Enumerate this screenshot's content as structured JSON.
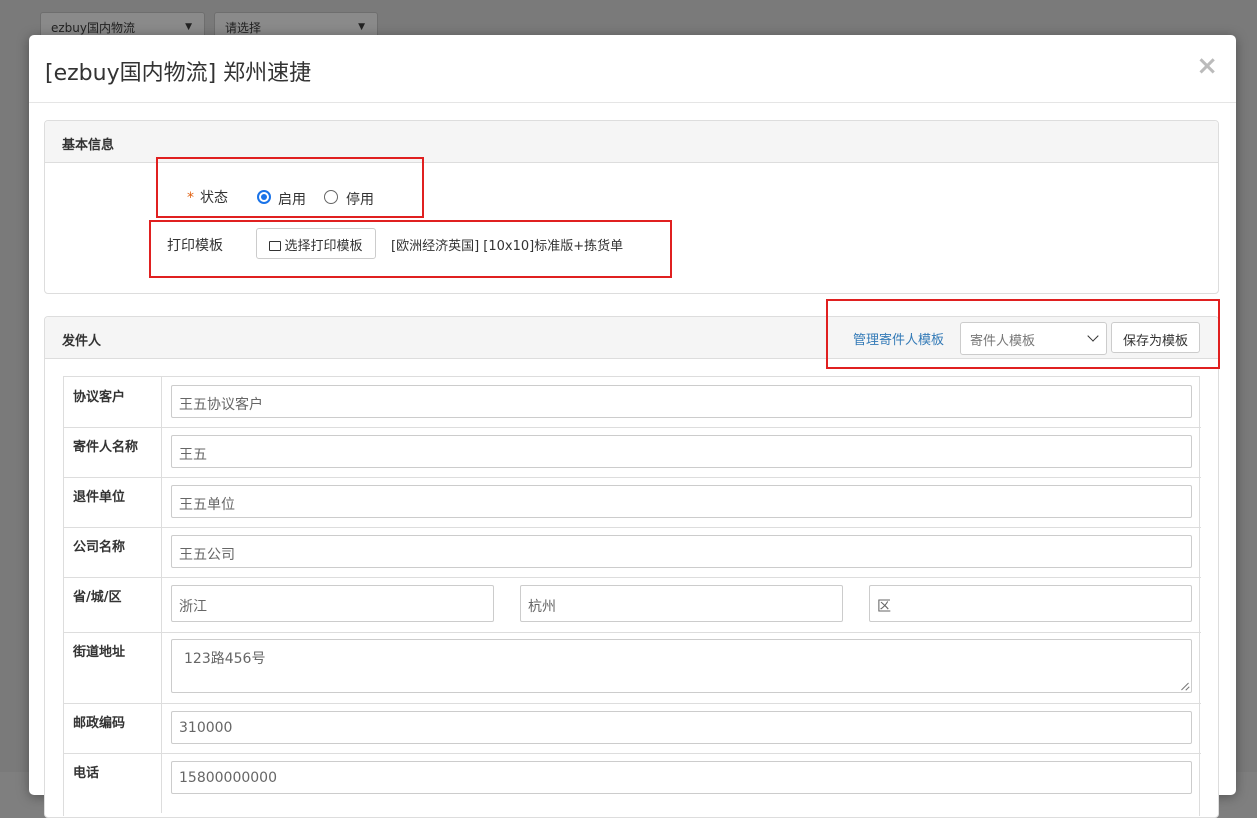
{
  "background": {
    "carrier_select": "ezbuy国内物流",
    "second_select": "请选择"
  },
  "modal": {
    "title": "[ezbuy国内物流] 郑州速捷",
    "close_icon": "×"
  },
  "basic_info": {
    "heading": "基本信息",
    "status_required_mark": "*",
    "status_label": "状态",
    "status_options": [
      {
        "label": "启用",
        "selected": true
      },
      {
        "label": "停用",
        "selected": false
      }
    ],
    "print_template_label": "打印模板",
    "select_template_button": "选择打印模板",
    "current_template": "[欧洲经济英国] [10x10]标准版+拣货单"
  },
  "sender": {
    "heading": "发件人",
    "manage_link": "管理寄件人模板",
    "template_select": "寄件人模板",
    "save_template_button": "保存为模板",
    "fields": {
      "agreement_customer": {
        "label": "协议客户",
        "value": "王五协议客户"
      },
      "sender_name": {
        "label": "寄件人名称",
        "value": "王五"
      },
      "return_unit": {
        "label": "退件单位",
        "value": "王五单位"
      },
      "company": {
        "label": "公司名称",
        "value": "王五公司"
      },
      "region": {
        "label": "省/城/区",
        "province": "浙江",
        "city": "杭州",
        "district": "区"
      },
      "street": {
        "label": "街道地址",
        "value": "123路456号"
      },
      "postal": {
        "label": "邮政编码",
        "value": "310000"
      },
      "phone": {
        "label": "电话",
        "value": "15800000000"
      }
    }
  },
  "colors": {
    "accent": "#1a73e8",
    "link": "#337ab7",
    "highlight_box": "#e02020"
  }
}
